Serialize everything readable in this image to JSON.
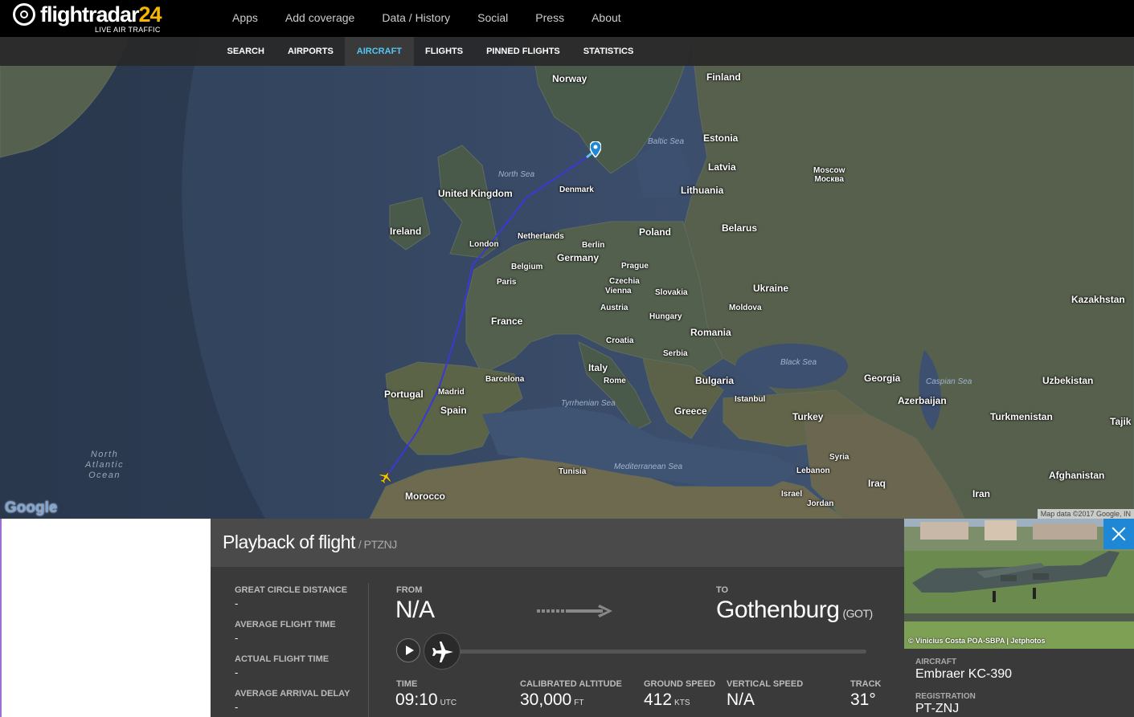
{
  "brand": {
    "name": "flightradar",
    "num": "24",
    "tagline": "LIVE AIR TRAFFIC"
  },
  "main_nav": [
    "Apps",
    "Add coverage",
    "Data / History",
    "Social",
    "Press",
    "About"
  ],
  "sub_nav": {
    "items": [
      "SEARCH",
      "AIRPORTS",
      "AIRCRAFT",
      "FLIGHTS",
      "PINNED FLIGHTS",
      "STATISTICS"
    ],
    "active": "AIRCRAFT"
  },
  "map": {
    "countries": [
      {
        "name": "Norway"
      },
      {
        "name": "Finland"
      },
      {
        "name": "Estonia"
      },
      {
        "name": "Latvia"
      },
      {
        "name": "Lithuania"
      },
      {
        "name": "United Kingdom"
      },
      {
        "name": "Ireland"
      },
      {
        "name": "Denmark"
      },
      {
        "name": "Netherlands"
      },
      {
        "name": "Belgium"
      },
      {
        "name": "Germany"
      },
      {
        "name": "Poland"
      },
      {
        "name": "Belarus"
      },
      {
        "name": "Czechia"
      },
      {
        "name": "Slovakia"
      },
      {
        "name": "Ukraine"
      },
      {
        "name": "Austria"
      },
      {
        "name": "Hungary"
      },
      {
        "name": "Moldova"
      },
      {
        "name": "Romania"
      },
      {
        "name": "France"
      },
      {
        "name": "Croatia"
      },
      {
        "name": "Serbia"
      },
      {
        "name": "Italy"
      },
      {
        "name": "Bulgaria"
      },
      {
        "name": "Portugal"
      },
      {
        "name": "Spain"
      },
      {
        "name": "Greece"
      },
      {
        "name": "Turkey"
      },
      {
        "name": "Georgia"
      },
      {
        "name": "Azerbaijan"
      },
      {
        "name": "Kazakhstan"
      },
      {
        "name": "Uzbekistan"
      },
      {
        "name": "Turkmenistan"
      },
      {
        "name": "Tajik"
      },
      {
        "name": "Afghanistan"
      },
      {
        "name": "Iran"
      },
      {
        "name": "Iraq"
      },
      {
        "name": "Syria"
      },
      {
        "name": "Lebanon"
      },
      {
        "name": "Israel"
      },
      {
        "name": "Jordan"
      },
      {
        "name": "Tunisia"
      },
      {
        "name": "Morocco"
      }
    ],
    "cities": [
      {
        "name": "London"
      },
      {
        "name": "Paris"
      },
      {
        "name": "Berlin"
      },
      {
        "name": "Prague"
      },
      {
        "name": "Vienna"
      },
      {
        "name": "Madrid"
      },
      {
        "name": "Barcelona"
      },
      {
        "name": "Rome"
      },
      {
        "name": "Istanbul"
      },
      {
        "name": "Moscow\nМосква"
      }
    ],
    "seas": [
      "Baltic Sea",
      "North Sea",
      "Black Sea",
      "Caspian Sea",
      "Tyrrhenian Sea",
      "Mediterranean Sea"
    ],
    "ocean": "North\nAtlantic\nOcean",
    "google": "Google",
    "map_data": "Map data ©2017 Google, IN"
  },
  "playback": {
    "title": "Playback of flight",
    "registration_suffix": "/ PTZNJ",
    "stats": [
      {
        "label": "GREAT CIRCLE DISTANCE",
        "value": "-"
      },
      {
        "label": "AVERAGE FLIGHT TIME",
        "value": "-"
      },
      {
        "label": "ACTUAL FLIGHT TIME",
        "value": "-"
      },
      {
        "label": "AVERAGE ARRIVAL DELAY",
        "value": "-"
      }
    ],
    "from_label": "FROM",
    "from_value": "N/A",
    "to_label": "TO",
    "to_value": "Gothenburg",
    "to_code": "(GOT)",
    "progress": 0.0,
    "metrics": [
      {
        "label": "TIME",
        "value": "09:10",
        "unit": "UTC"
      },
      {
        "label": "CALIBRATED ALTITUDE",
        "value": "30,000",
        "unit": "FT"
      },
      {
        "label": "GROUND SPEED",
        "value": "412",
        "unit": "KTS"
      },
      {
        "label": "VERTICAL SPEED",
        "value": "N/A",
        "unit": ""
      },
      {
        "label": "TRACK",
        "value": "31°",
        "unit": ""
      }
    ]
  },
  "aircraft": {
    "photo_credit": "© Vinicius Costa POA-SBPA | Jetphotos",
    "aircraft_label": "AIRCRAFT",
    "aircraft_value": "Embraer KC-390",
    "registration_label": "REGISTRATION",
    "registration_value": "PT-ZNJ"
  },
  "colors": {
    "accent": "#54c6f3",
    "route": "#3b38d6",
    "close_button": "#1e88d6",
    "brand_orange": "#f6b700"
  }
}
